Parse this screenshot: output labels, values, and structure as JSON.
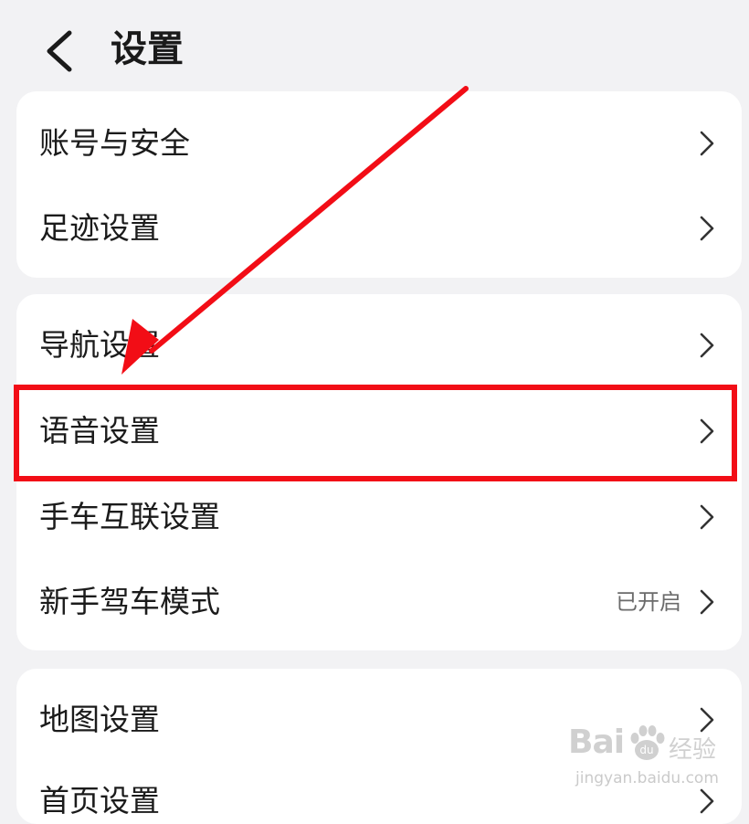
{
  "header": {
    "title": "设置"
  },
  "groups": [
    {
      "items": [
        {
          "label": "账号与安全"
        },
        {
          "label": "足迹设置"
        }
      ]
    },
    {
      "items": [
        {
          "label": "导航设置"
        },
        {
          "label": "语音设置"
        },
        {
          "label": "手车互联设置"
        },
        {
          "label": "新手驾车模式",
          "value": "已开启"
        }
      ]
    },
    {
      "items": [
        {
          "label": "地图设置"
        },
        {
          "label": "首页设置"
        }
      ]
    }
  ],
  "annotation": {
    "color": "#f20d16",
    "highlighted_item": "语音设置"
  },
  "watermark": {
    "brand": "Bai",
    "jy": "经验",
    "url": "jingyan.baidu.com"
  },
  "icons": [
    "back-arrow-icon",
    "chevron-right-icon",
    "baidu-paw-icon"
  ]
}
